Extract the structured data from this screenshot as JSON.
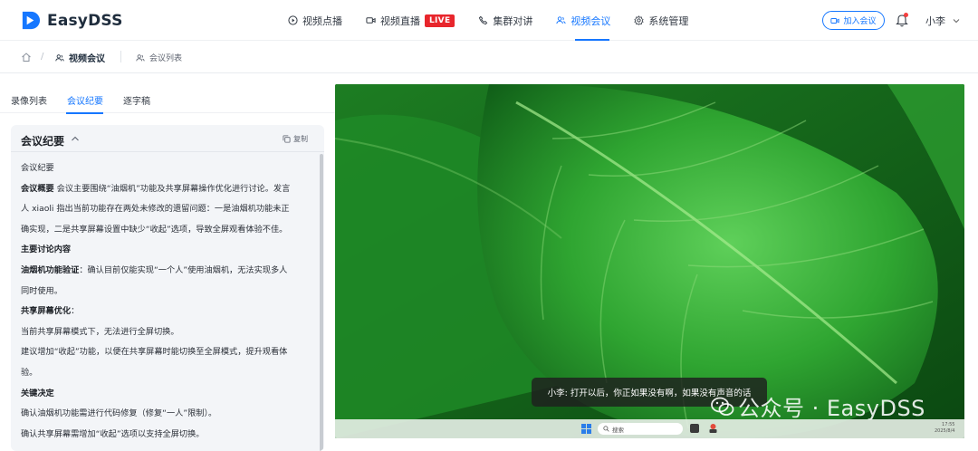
{
  "app": {
    "name": "EasyDSS",
    "brand_color": "#1677ff"
  },
  "nav": {
    "items": [
      {
        "label": "视频点播",
        "icon": "play-circle-icon"
      },
      {
        "label": "视频直播",
        "icon": "video-camera-icon",
        "badge": "LIVE"
      },
      {
        "label": "集群对讲",
        "icon": "phone-icon"
      },
      {
        "label": "视频会议",
        "icon": "meeting-users-icon",
        "active": true
      },
      {
        "label": "系统管理",
        "icon": "gear-icon"
      }
    ],
    "join_meeting": "加入会议",
    "user": "小李"
  },
  "breadcrumb": {
    "section": "视频会议",
    "page": "会议列表"
  },
  "tabs": {
    "items": [
      "录像列表",
      "会议纪要",
      "逐字稿"
    ],
    "active_index": 1
  },
  "summary": {
    "title": "会议纪要",
    "copy_label": "复制",
    "lines": {
      "l1": "会议纪要",
      "l2_bold": "会议概要",
      "l2_text": " 会议主要围绕“油烟机”功能及共享屏幕操作优化进行讨论。发言",
      "l3": "人 xiaoli 指出当前功能存在两处未修改的遗留问题：一是油烟机功能未正",
      "l4": "确实现，二是共享屏幕设置中缺少“收起”选项，导致全屏观看体验不佳。",
      "l5_bold": "主要讨论内容",
      "l6_bold": "油烟机功能验证",
      "l6_text": "：确认目前仅能实现“一个人”使用油烟机，无法实现多人",
      "l7": "同时使用。",
      "l8_bold": "共享屏幕优化",
      "l8_text": "：",
      "l9": "当前共享屏幕模式下，无法进行全屏切换。",
      "l10": "建议增加“收起”功能，以便在共享屏幕时能切换至全屏模式，提升观看体",
      "l11": "验。",
      "l12_bold": "关键决定",
      "l13": "确认油烟机功能需进行代码修复（修复“一人”限制）。",
      "l14": "确认共享屏幕需增加“收起”选项以支持全屏切换。"
    }
  },
  "video": {
    "subtitle": "小李: 打开以后，你正如果没有啊，如果没有声音的话",
    "watermark": "公众号 · EasyDSS",
    "taskbar_search": "搜索",
    "taskbar_time": "17:55",
    "taskbar_date": "2025/8/4"
  }
}
